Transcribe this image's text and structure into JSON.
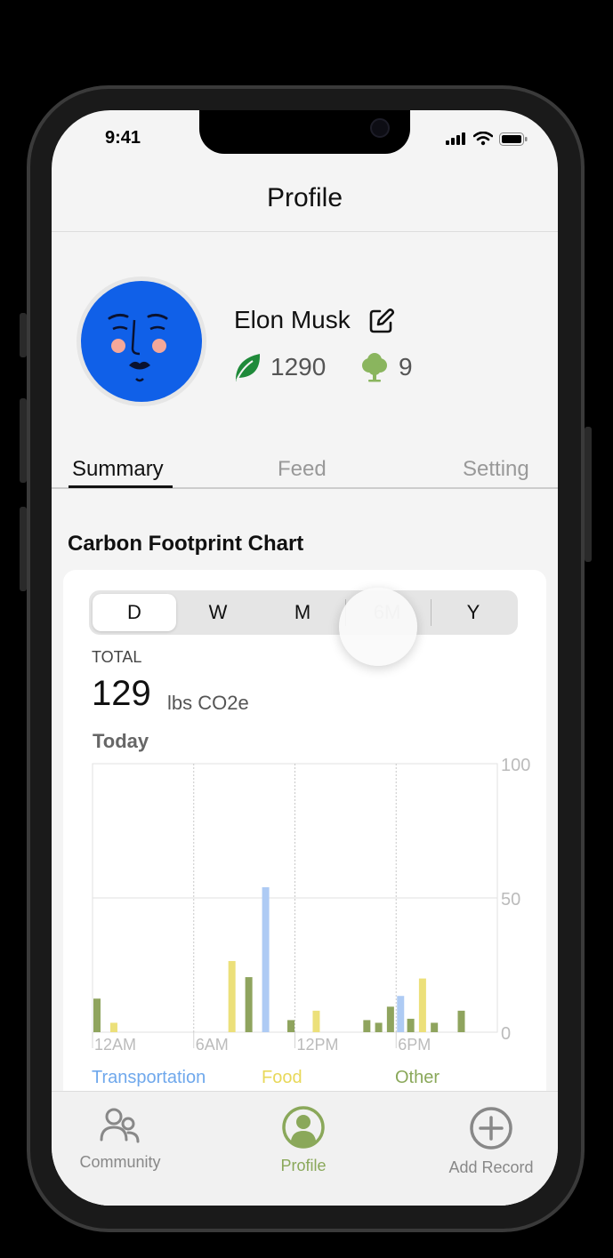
{
  "status_bar": {
    "time": "9:41"
  },
  "header": {
    "title": "Profile"
  },
  "profile": {
    "name": "Elon Musk",
    "leaf_count": "1290",
    "tree_count": "9"
  },
  "tabs": [
    {
      "label": "Summary",
      "active": true
    },
    {
      "label": "Feed",
      "active": false
    },
    {
      "label": "Setting",
      "active": false
    }
  ],
  "section_title": "Carbon Footprint Chart",
  "range_selector": {
    "options": [
      "D",
      "W",
      "M",
      "6M",
      "Y"
    ],
    "selected": "D"
  },
  "total": {
    "label": "TOTAL",
    "value": "129",
    "unit": "lbs CO2e"
  },
  "period_label": "Today",
  "chart_data": {
    "type": "bar",
    "x_tick_labels": [
      "12AM",
      "6AM",
      "12PM",
      "6PM"
    ],
    "y_tick_labels": [
      "100",
      "50",
      "0"
    ],
    "ylim": [
      0,
      100
    ],
    "bars": [
      {
        "hour": 0,
        "series": "Other",
        "value": 12.5
      },
      {
        "hour": 1,
        "series": "Food",
        "value": 3.5
      },
      {
        "hour": 8,
        "series": "Food",
        "value": 26.5
      },
      {
        "hour": 9,
        "series": "Other",
        "value": 20.5
      },
      {
        "hour": 10,
        "series": "Transportation",
        "value": 54
      },
      {
        "hour": 11.5,
        "series": "Other",
        "value": 4.5
      },
      {
        "hour": 13,
        "series": "Food",
        "value": 8
      },
      {
        "hour": 16,
        "series": "Other",
        "value": 4.5
      },
      {
        "hour": 16.7,
        "series": "Other",
        "value": 3.5
      },
      {
        "hour": 17.4,
        "series": "Other",
        "value": 9.5
      },
      {
        "hour": 18,
        "series": "Transportation",
        "value": 13.5
      },
      {
        "hour": 18.6,
        "series": "Other",
        "value": 5
      },
      {
        "hour": 19.3,
        "series": "Food",
        "value": 20
      },
      {
        "hour": 20,
        "series": "Other",
        "value": 3.5
      },
      {
        "hour": 21.6,
        "series": "Other",
        "value": 8
      }
    ],
    "legend": [
      {
        "name": "Transportation",
        "color": "#6fa8ec"
      },
      {
        "name": "Food",
        "color": "#e8d85a"
      },
      {
        "name": "Other",
        "color": "#8aa85a"
      }
    ],
    "series_colors": {
      "Transportation": "#aecbf4",
      "Food": "#ece07a",
      "Other": "#8fa45e"
    }
  },
  "tab_bar": [
    {
      "label": "Community",
      "icon": "people-icon",
      "active": false
    },
    {
      "label": "Profile",
      "icon": "person-circle-icon",
      "active": true
    },
    {
      "label": "Add Record",
      "icon": "plus-circle-icon",
      "active": false
    }
  ],
  "colors": {
    "accent_green": "#8aa85a",
    "avatar_blue": "#1060e8",
    "leaf_green": "#1f8a3a",
    "tree_green": "#8ab55e"
  }
}
